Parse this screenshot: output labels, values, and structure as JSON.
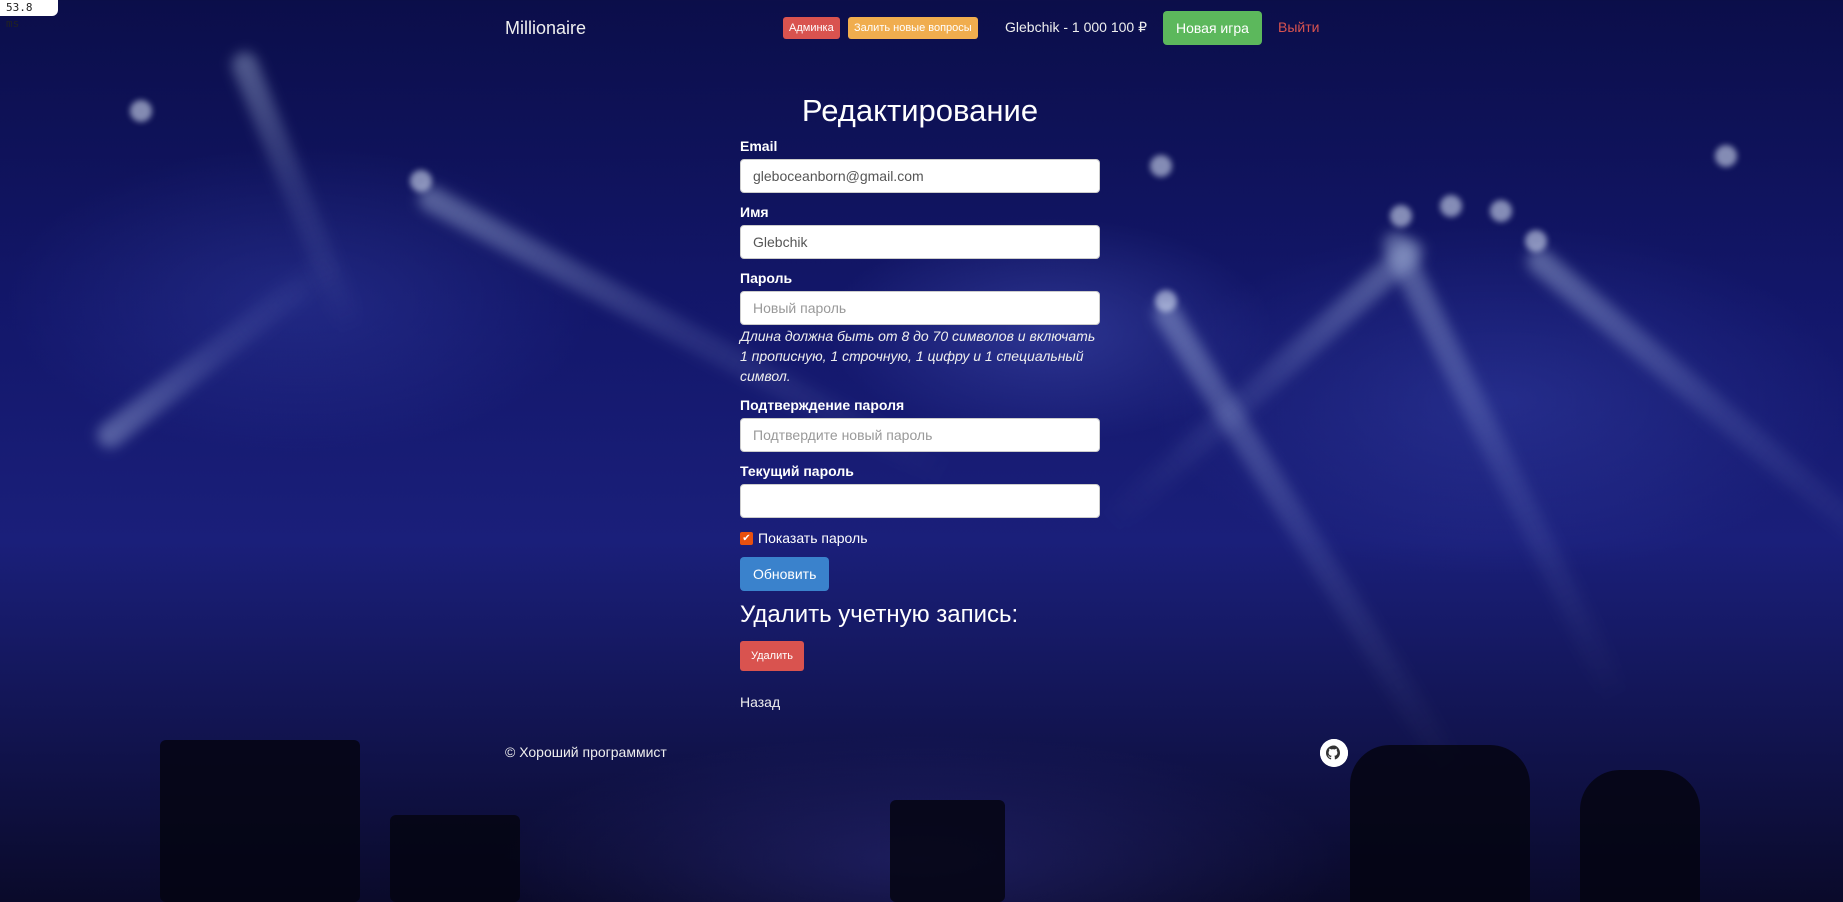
{
  "perf": "53.8 ms",
  "navbar": {
    "brand": "Millionaire",
    "admin_badge": "Админка",
    "upload_badge": "Залить новые вопросы",
    "user_balance": "Glebchik - 1 000 100 ₽",
    "new_game": "Новая игра",
    "logout": "Выйти"
  },
  "form": {
    "title": "Редактирование",
    "email_label": "Email",
    "email_value": "gleboceanborn@gmail.com",
    "name_label": "Имя",
    "name_value": "Glebchik",
    "password_label": "Пароль",
    "password_placeholder": "Новый пароль",
    "password_hint": "Длина должна быть от 8 до 70 символов и включать 1 прописную, 1 строчную, 1 цифру и 1 специальный символ.",
    "confirm_label": "Подтверждение пароля",
    "confirm_placeholder": "Подтвердите новый пароль",
    "current_label": "Текущий пароль",
    "current_value": "",
    "show_password_label": "Показать пароль",
    "show_password_checked": true,
    "update_button": "Обновить"
  },
  "delete_section": {
    "title": "Удалить учетную запись:",
    "delete_button": "Удалить"
  },
  "back_link": "Назад",
  "footer": {
    "copyright": "© Хороший программист",
    "icon": "github-icon"
  },
  "colors": {
    "admin_badge": "#d9534f",
    "upload_badge": "#f0ad4e",
    "new_game": "#5cb85c",
    "logout": "#d9534f",
    "update": "#3a82cc",
    "delete": "#d9534f",
    "checkbox": "#e8500f"
  }
}
